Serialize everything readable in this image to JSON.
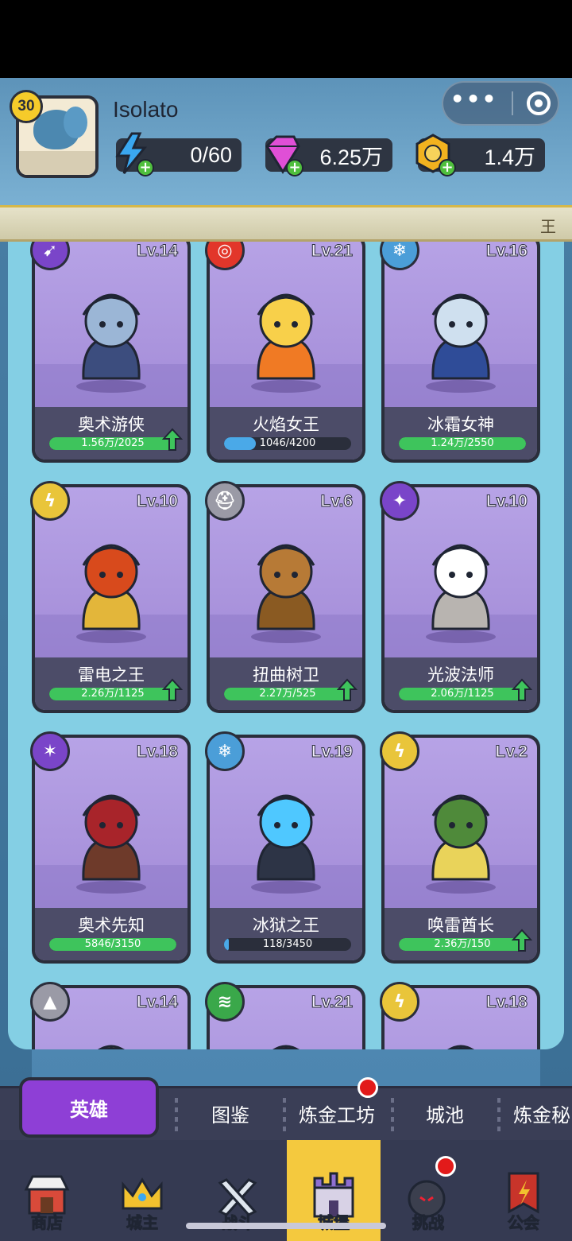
{
  "player": {
    "name": "Isolato",
    "level": "30"
  },
  "resources": {
    "energy": "0/60",
    "gems": "6.25万",
    "gold": "1.4万"
  },
  "capsule": {
    "more": "•••"
  },
  "banner": {
    "marquee": "王"
  },
  "heroes": [
    {
      "name": "奥术游侠",
      "level": "Lv.14",
      "progress": "1.56万/2025",
      "fill": 1.0,
      "fill_color": "#3ec45c",
      "elem_color": "#7a45c9",
      "elem_glyph": "➹",
      "upgrade": true
    },
    {
      "name": "火焰女王",
      "level": "Lv.21",
      "progress": "1046/4200",
      "fill": 0.25,
      "fill_color": "#4aa9e8",
      "elem_color": "#e2362a",
      "elem_glyph": "◎",
      "upgrade": false
    },
    {
      "name": "冰霜女神",
      "level": "Lv.16",
      "progress": "1.24万/2550",
      "fill": 1.0,
      "fill_color": "#3ec45c",
      "elem_color": "#4b9ed8",
      "elem_glyph": "❄",
      "upgrade": false
    },
    {
      "name": "雷电之王",
      "level": "Lv.10",
      "progress": "2.26万/1125",
      "fill": 1.0,
      "fill_color": "#3ec45c",
      "elem_color": "#e9c53a",
      "elem_glyph": "ϟ",
      "upgrade": true
    },
    {
      "name": "扭曲树卫",
      "level": "Lv.6",
      "progress": "2.27万/525",
      "fill": 1.0,
      "fill_color": "#3ec45c",
      "elem_color": "#9a9aa6",
      "elem_glyph": "⛑",
      "upgrade": true
    },
    {
      "name": "光波法师",
      "level": "Lv.10",
      "progress": "2.06万/1125",
      "fill": 1.0,
      "fill_color": "#3ec45c",
      "elem_color": "#7a45c9",
      "elem_glyph": "✦",
      "upgrade": true
    },
    {
      "name": "奥术先知",
      "level": "Lv.18",
      "progress": "5846/3150",
      "fill": 1.0,
      "fill_color": "#3ec45c",
      "elem_color": "#7a45c9",
      "elem_glyph": "✶",
      "upgrade": false
    },
    {
      "name": "冰狱之王",
      "level": "Lv.19",
      "progress": "118/3450",
      "fill": 0.04,
      "fill_color": "#4aa9e8",
      "elem_color": "#4b9ed8",
      "elem_glyph": "❄",
      "upgrade": false
    },
    {
      "name": "唤雷酋长",
      "level": "Lv.2",
      "progress": "2.36万/150",
      "fill": 1.0,
      "fill_color": "#3ec45c",
      "elem_color": "#e9c53a",
      "elem_glyph": "ϟ",
      "upgrade": true
    },
    {
      "name": "",
      "level": "Lv.14",
      "progress": "",
      "fill": 0,
      "fill_color": "#3ec45c",
      "elem_color": "#9a9aa6",
      "elem_glyph": "▲",
      "upgrade": false
    },
    {
      "name": "",
      "level": "Lv.21",
      "progress": "",
      "fill": 0,
      "fill_color": "#3ec45c",
      "elem_color": "#3aa84a",
      "elem_glyph": "≋",
      "upgrade": false
    },
    {
      "name": "",
      "level": "Lv.18",
      "progress": "",
      "fill": 0,
      "fill_color": "#3ec45c",
      "elem_color": "#e9c53a",
      "elem_glyph": "ϟ",
      "upgrade": false
    }
  ],
  "subtabs": {
    "active": "英雄",
    "items": [
      "图鉴",
      "炼金工坊",
      "城池",
      "炼金秘"
    ]
  },
  "nav": [
    {
      "label": "商店",
      "icon": "shop-icon"
    },
    {
      "label": "城主",
      "icon": "crown-icon"
    },
    {
      "label": "战斗",
      "icon": "swords-icon"
    },
    {
      "label": "城堡",
      "icon": "castle-icon"
    },
    {
      "label": "挑战",
      "icon": "bomb-icon"
    },
    {
      "label": "公会",
      "icon": "guild-banner-icon"
    }
  ]
}
